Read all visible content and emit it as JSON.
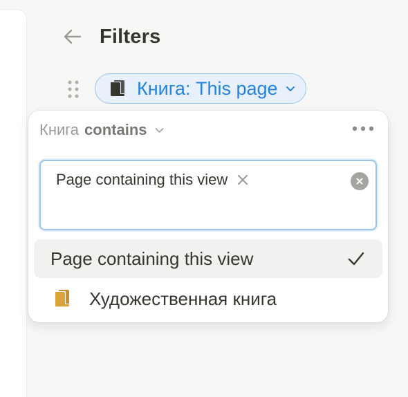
{
  "header": {
    "title": "Filters"
  },
  "filter_chip": {
    "label": "Книга: This page"
  },
  "popover": {
    "property": "Книга",
    "operator": "contains",
    "token": "Page containing this view",
    "options": [
      {
        "label": "Page containing this view",
        "selected": true
      },
      {
        "label": "Художественная книга",
        "selected": false
      }
    ]
  },
  "colors": {
    "accent": "#2383e2",
    "chip_bg": "#e8f1fb",
    "chip_border": "#9cc4ea",
    "book_icon_orange": "#d9a53a",
    "text": "#37352f",
    "muted": "#9b9a97",
    "background": "#f7f7f5"
  },
  "icons": {
    "back": "arrow-left-icon",
    "drag": "drag-handle-icon",
    "chip_book": "book-icon",
    "chevron": "chevron-down-icon",
    "more": "more-horizontal-icon",
    "token_remove": "close-icon",
    "clear": "clear-circle-icon",
    "check": "checkmark-icon",
    "option_book": "book-icon"
  }
}
